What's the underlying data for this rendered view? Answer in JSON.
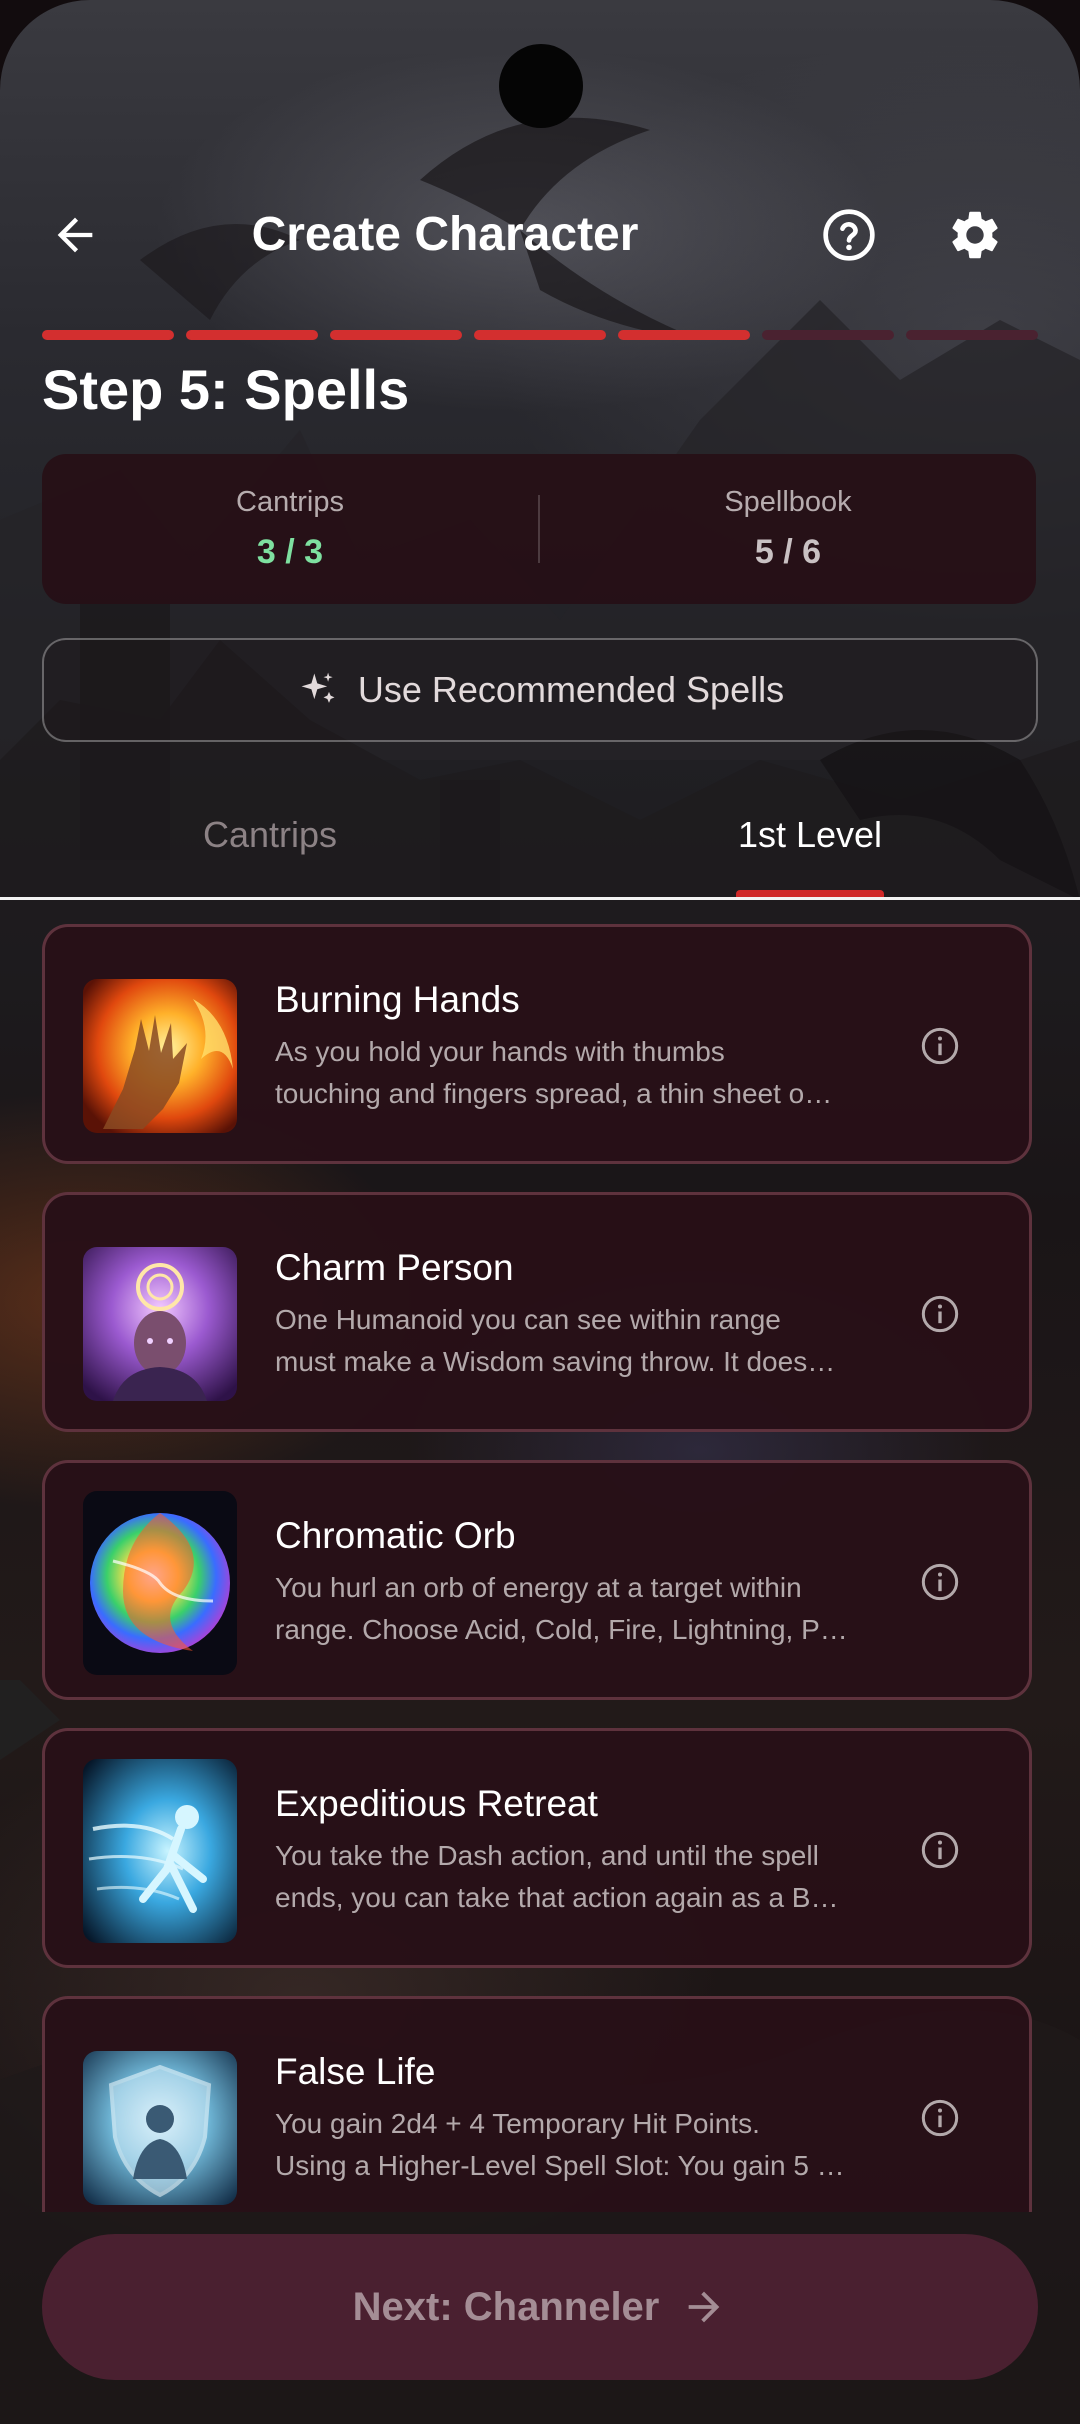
{
  "header": {
    "title": "Create Character",
    "back_icon": "arrow-left-icon",
    "help_icon": "help-circle-icon",
    "settings_icon": "gear-icon"
  },
  "progress": {
    "total_steps": 7,
    "completed_steps": 5,
    "active_color": "#d32f2f",
    "inactive_color": "#4a2230"
  },
  "step_title": "Step 5: Spells",
  "summary": {
    "cantrips_label": "Cantrips",
    "cantrips_value": "3 / 3",
    "cantrips_color": "#7ee0a0",
    "spellbook_label": "Spellbook",
    "spellbook_value": "5 / 6",
    "spellbook_color": "#c9c1c3"
  },
  "recommend_button": {
    "label": "Use Recommended Spells",
    "icon": "sparkles-icon"
  },
  "tabs": [
    {
      "label": "Cantrips",
      "selected": false
    },
    {
      "label": "1st Level",
      "selected": true
    }
  ],
  "spells": [
    {
      "name": "Burning Hands",
      "desc_line1": "As you hold your hands with thumbs",
      "desc_line2": "touching and fingers spread, a thin sheet o…",
      "image": "burning-hands-image"
    },
    {
      "name": "Charm Person",
      "desc_line1": "One Humanoid you can see within range",
      "desc_line2": "must make a Wisdom saving throw. It does…",
      "image": "charm-person-image"
    },
    {
      "name": "Chromatic Orb",
      "desc_line1": "You hurl an orb of energy at a target within",
      "desc_line2": "range. Choose Acid, Cold, Fire, Lightning, P…",
      "image": "chromatic-orb-image"
    },
    {
      "name": "Expeditious Retreat",
      "desc_line1": "You take the Dash action, and until the spell",
      "desc_line2": "ends, you can take that action again as a B…",
      "image": "expeditious-retreat-image"
    },
    {
      "name": "False Life",
      "desc_line1": "You gain 2d4 + 4 Temporary Hit Points.",
      "desc_line2": "Using a Higher-Level Spell Slot: You gain 5 …",
      "image": "false-life-image"
    }
  ],
  "next_button": {
    "label": "Next: Channeler",
    "icon": "arrow-right-icon"
  }
}
